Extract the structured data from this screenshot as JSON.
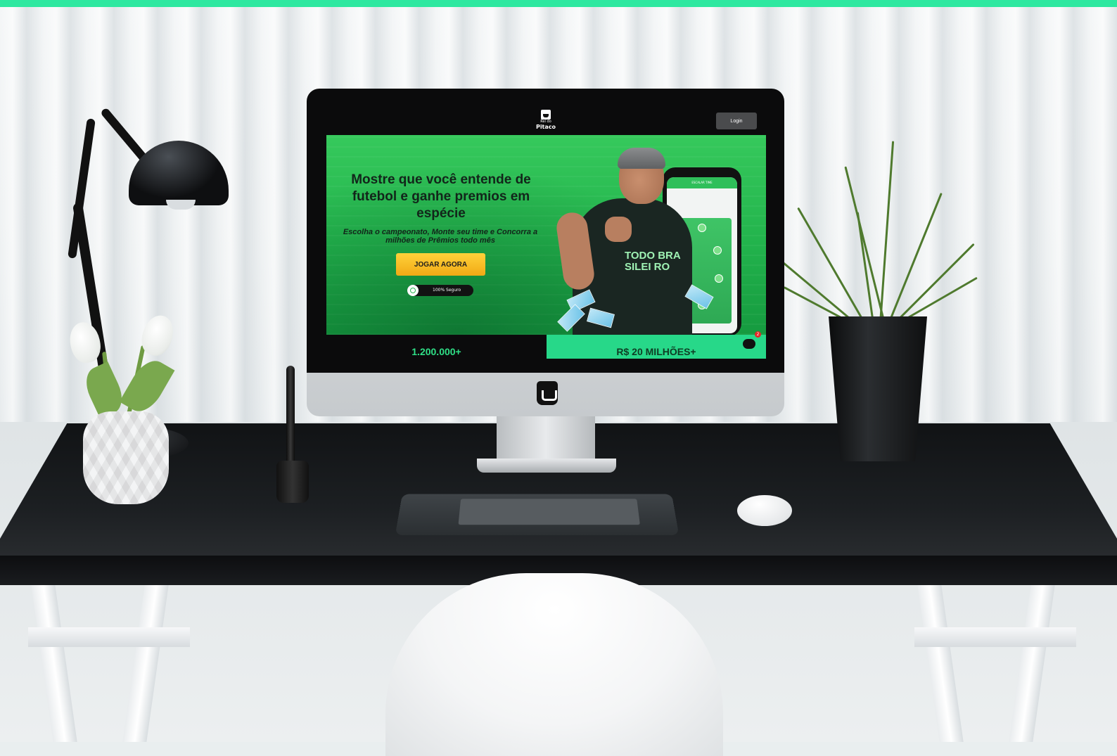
{
  "colors": {
    "top_accent": "#2ee8a0",
    "hero_green": "#22b34c",
    "cta_yellow": "#f5b81f",
    "stat_green": "#27d889"
  },
  "site": {
    "brand": {
      "line1": "Rei do",
      "name": "Pitaco",
      "icon": "crown-logo-icon"
    },
    "header": {
      "login_label": "Login"
    },
    "hero": {
      "title": "Mostre que você entende de futebol e ganhe premios em espécie",
      "subtitle": "Escolha o campeonato, Monte seu time e Concorra a milhões de Prêmios todo mês",
      "cta_label": "JOGAR AGORA",
      "secure_label": "100% Seguro",
      "shirt_text": "TODO BRA SILEI RO",
      "phone_header": "ESCALAR TIME"
    },
    "stats": {
      "left_value": "1.200.000+",
      "right_value": "R$ 20 MILHÕES+"
    },
    "chat": {
      "badge_count": "2",
      "icon": "chat-bubble-icon"
    }
  }
}
